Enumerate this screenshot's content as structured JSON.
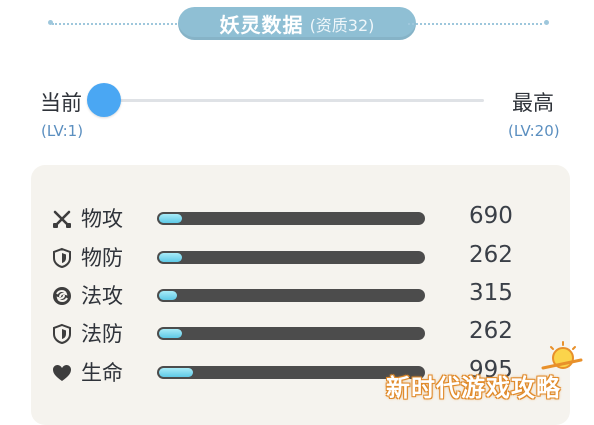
{
  "header": {
    "title": "妖灵数据",
    "subtitle": "(资质32)"
  },
  "level": {
    "current_label": "当前",
    "current_sub": "(LV:1)",
    "max_label": "最高",
    "max_sub": "(LV:20)",
    "current": 1,
    "max": 20,
    "accent": "#4aa7f3"
  },
  "stats": [
    {
      "icon": "crossed-swords-icon",
      "name": "物攻",
      "value": "690",
      "fill": 0.05
    },
    {
      "icon": "shield-icon",
      "name": "物防",
      "value": "262",
      "fill": 0.05
    },
    {
      "icon": "swirl-magic-icon",
      "name": "法攻",
      "value": "315",
      "fill": 0.03
    },
    {
      "icon": "shield-icon",
      "name": "法防",
      "value": "262",
      "fill": 0.05
    },
    {
      "icon": "heart-icon",
      "name": "生命",
      "value": "995",
      "fill": 0.09
    }
  ],
  "watermark": "新时代游戏攻略",
  "colors": {
    "title_pill": "#8fbfd4",
    "bar_track": "#4c4c4c",
    "bar_fill": "#5fc9e6",
    "panel": "#f5f3ee"
  }
}
